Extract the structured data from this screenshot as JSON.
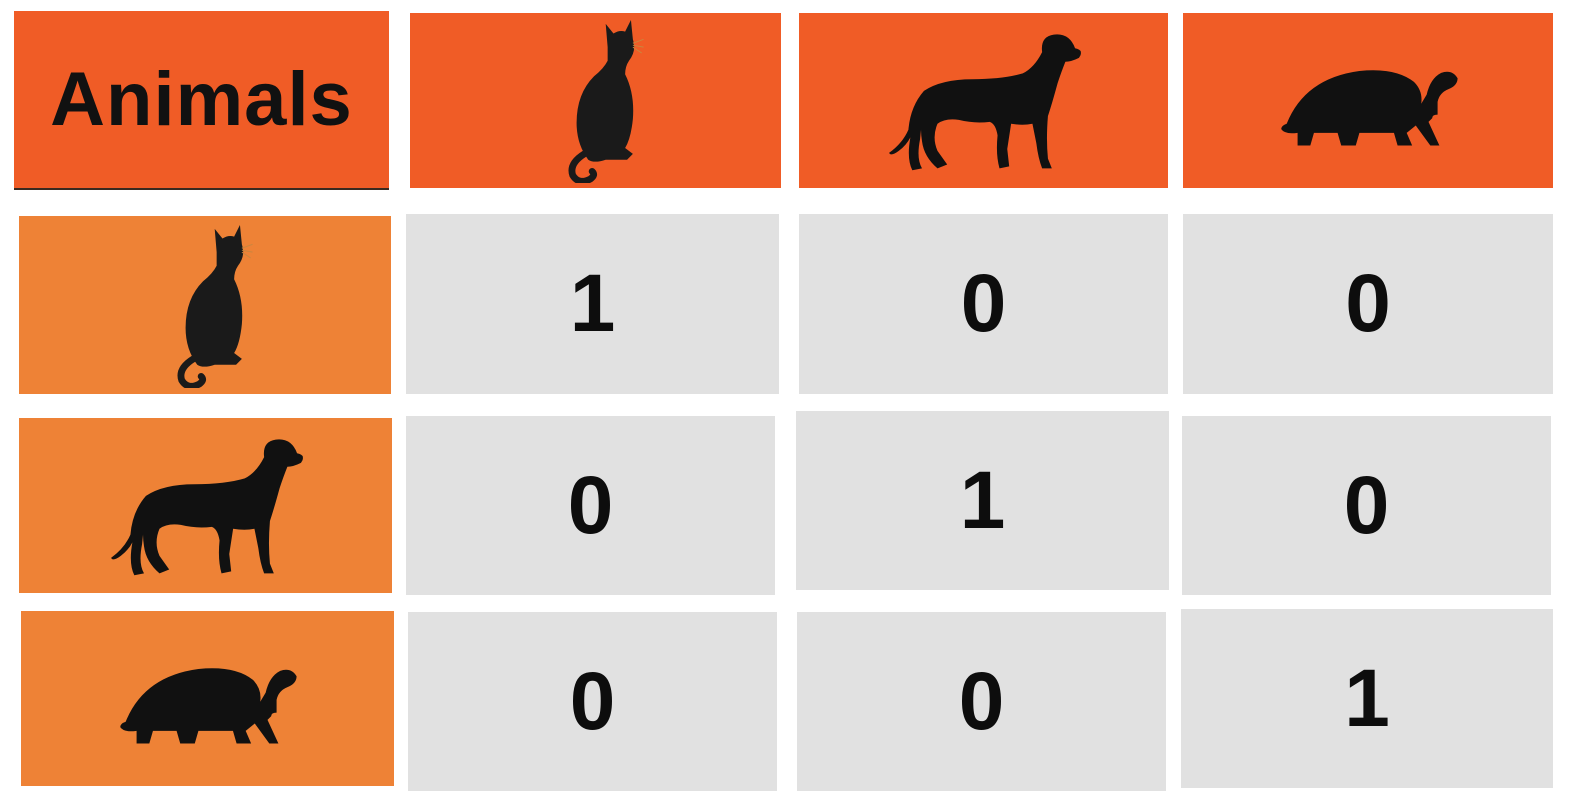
{
  "header": {
    "title": "Animals",
    "columns": [
      {
        "icon": "cat-icon"
      },
      {
        "icon": "dog-icon"
      },
      {
        "icon": "turtle-icon"
      }
    ]
  },
  "rows": [
    {
      "icon": "cat-icon",
      "values": [
        "1",
        "0",
        "0"
      ]
    },
    {
      "icon": "dog-icon",
      "values": [
        "0",
        "1",
        "0"
      ]
    },
    {
      "icon": "turtle-icon",
      "values": [
        "0",
        "0",
        "1"
      ]
    }
  ],
  "colors": {
    "header": "#f05c26",
    "row_header": "#ee8236",
    "value_cell": "#e1e1e1",
    "silhouette": "#111111"
  }
}
